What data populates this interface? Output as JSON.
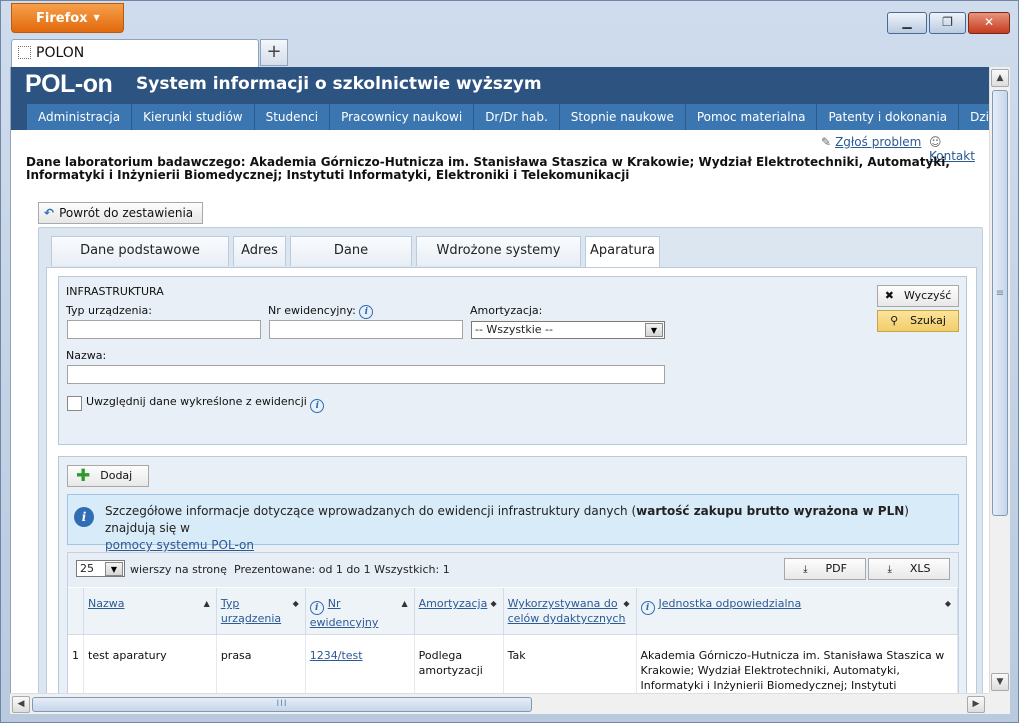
{
  "browser": {
    "app_button": "Firefox",
    "tab_title": "POLON",
    "new_tab_label": "+"
  },
  "header": {
    "logo": "POL-on",
    "system_name": "System informacji o szkolnictwie wyższym"
  },
  "nav": {
    "items": [
      "Administracja",
      "Kierunki studiów",
      "Studenci",
      "Pracownicy naukowi",
      "Dr/Dr hab.",
      "Stopnie naukowe",
      "Pomoc materialna",
      "Patenty i dokonania",
      "Działania upowsze"
    ]
  },
  "util": {
    "report_problem": "Zgłoś problem",
    "contact": "Kontakt"
  },
  "page": {
    "title": "Dane laboratorium badawczego: Akademia Górniczo-Hutnicza im. Stanisława Staszica w Krakowie; Wydział Elektrotechniki, Automatyki, Informatyki i Inżynierii Biomedycznej; Instytuti Informatyki, Elektroniki i Telekomunikacji",
    "back_button": "Powrót do zestawienia"
  },
  "tabs": [
    "Dane podstawowe jednostki",
    "Adres",
    "Dane laboratorium",
    "Wdrożone systemy jakości",
    "Aparatura"
  ],
  "filter": {
    "section_title": "INFRASTRUKTURA",
    "device_type_label": "Typ urządzenia:",
    "device_type_value": "",
    "inventory_label": "Nr ewidencyjny:",
    "inventory_value": "",
    "amortization_label": "Amortyzacja:",
    "amortization_selected": "-- Wszystkie --",
    "name_label": "Nazwa:",
    "name_value": "",
    "include_deleted_label": "Uwzględnij dane wykreślone z ewidencji",
    "include_deleted_checked": false,
    "clear_button": "Wyczyść",
    "search_button": "Szukaj"
  },
  "list": {
    "add_button": "Dodaj",
    "notice_pre": "Szczegółowe informacje dotyczące wprowadzanych do ewidencji infrastruktury danych (",
    "notice_bold": "wartość zakupu brutto wyrażona w PLN",
    "notice_post": ") znajdują się w",
    "notice_link": "pomocy systemu POL-on",
    "page_size": "25",
    "page_size_label": "wierszy na stronę",
    "presented": "Prezentowane: od 1 do 1 Wszystkich: 1",
    "pdf_button": "PDF",
    "xls_button": "XLS",
    "columns": [
      "Nazwa",
      "Typ urządzenia",
      "Nr ewidencyjny",
      "Amortyzacja",
      "Wykorzystywana do celów dydaktycznych",
      "Jednostka odpowiedzialna"
    ],
    "rows": [
      {
        "num": "1",
        "name": "test aparatury",
        "type": "prasa",
        "inventory": "1234/test",
        "amortization": "Podlega amortyzacji",
        "didactic": "Tak",
        "unit": "Akademia Górniczo-Hutnicza im. Stanisława Staszica w Krakowie; Wydział Elektrotechniki, Automatyki, Informatyki i Inżynierii Biomedycznej; Instytuti Informatyki, Elektroniki i Telekomunikacji"
      }
    ]
  },
  "colors": {
    "header_bg": "#2d5380",
    "nav_bg": "#3c76b0",
    "panel_bg": "#dce6f0",
    "firefox_orange": "#e2690d"
  }
}
